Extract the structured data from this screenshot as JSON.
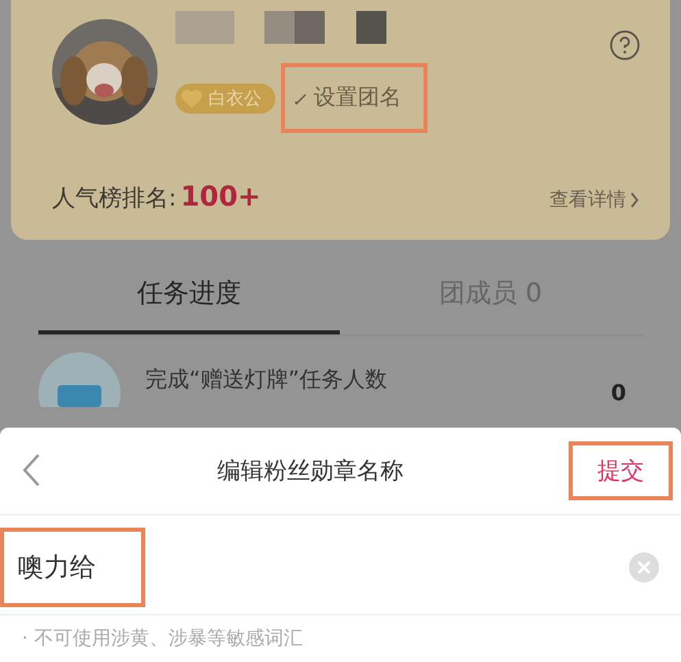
{
  "fan_club": {
    "badge": "白衣公",
    "set_name": {
      "label": "设置团名",
      "highlighted": true
    },
    "rank_label": "人气榜排名:",
    "rank_value": "100+",
    "details_link": "查看详情"
  },
  "tabs": [
    {
      "label": "任务进度",
      "selected": true
    },
    {
      "label": "团成员 0",
      "selected": false
    }
  ],
  "tasks": [
    {
      "title": "完成“赠送灯牌”任务人数",
      "count": "0"
    }
  ],
  "sheet": {
    "title": "编辑粉丝勋章名称",
    "submit": {
      "label": "提交",
      "highlighted": true
    },
    "input": {
      "value": "噢力给",
      "highlighted": true
    },
    "hint": "· 不可使用涉黄、涉暴等敏感词汇"
  }
}
